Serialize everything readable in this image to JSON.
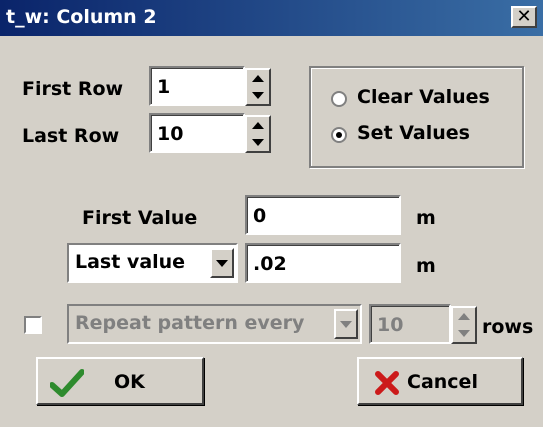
{
  "window": {
    "title": "t_w: Column 2",
    "close_glyph": "✕"
  },
  "rows": {
    "first_label": "First Row",
    "first_value": "1",
    "last_label": "Last Row",
    "last_value": "10"
  },
  "mode": {
    "options": [
      {
        "label": "Clear Values",
        "selected": false
      },
      {
        "label": "Set Values",
        "selected": true
      }
    ]
  },
  "values": {
    "first_label": "First Value",
    "first_value": "0",
    "first_unit": "m",
    "last_select": "Last value",
    "last_value": ".02",
    "last_unit": "m"
  },
  "repeat": {
    "checked": false,
    "select": "Repeat pattern every",
    "count": "10",
    "unit": "rows"
  },
  "buttons": {
    "ok_label": "OK",
    "cancel_label": "Cancel",
    "ok_color": "#2e8b2e",
    "cancel_color": "#cc1a1a"
  }
}
